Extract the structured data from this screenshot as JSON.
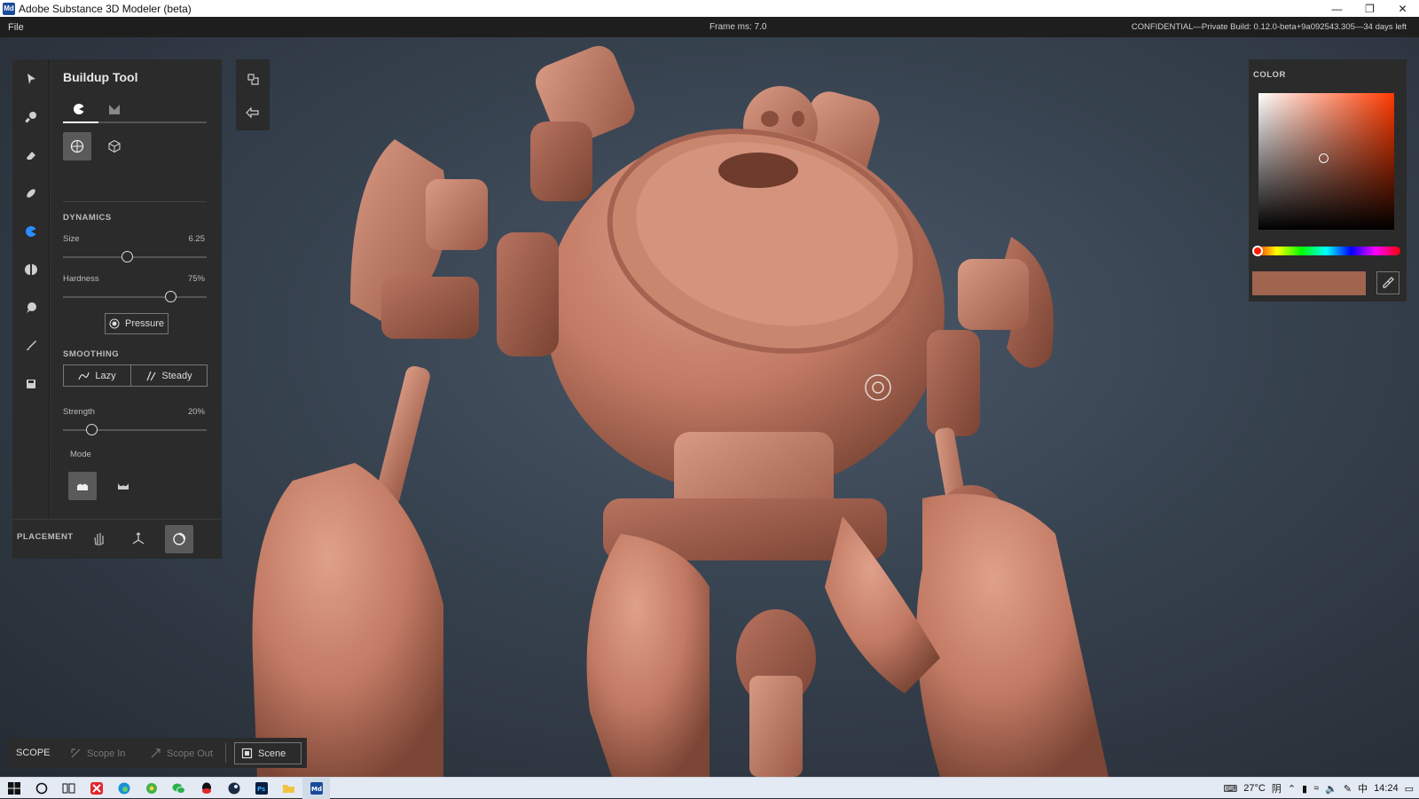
{
  "window": {
    "title": "Adobe Substance 3D Modeler (beta)",
    "app_icon_text": "Md"
  },
  "menubar": {
    "file": "File",
    "frame": "Frame ms: 7.0",
    "confidential": "CONFIDENTIAL—Private Build: 0.12.0-beta+9a092543.305—34 days left"
  },
  "tool_panel": {
    "title": "Buildup Tool",
    "dynamics_label": "DYNAMICS",
    "size_label": "Size",
    "size_value": "6.25",
    "size_fraction": 0.45,
    "hardness_label": "Hardness",
    "hardness_value": "75%",
    "hardness_fraction": 0.75,
    "pressure_label": "Pressure",
    "smoothing_label": "SMOOTHING",
    "lazy_label": "Lazy",
    "steady_label": "Steady",
    "strength_label": "Strength",
    "strength_value": "20%",
    "strength_fraction": 0.2,
    "mode_label": "Mode"
  },
  "placement": {
    "label": "PLACEMENT"
  },
  "color_panel": {
    "label": "COLOR",
    "swatch": "#a0644f",
    "hue": "#ff3a00"
  },
  "scope": {
    "label": "SCOPE",
    "scope_in": "Scope In",
    "scope_out": "Scope Out",
    "scene": "Scene"
  },
  "taskbar": {
    "temperature": "27°C",
    "ime1": "阴",
    "ime2": "中",
    "time": "14:24"
  },
  "colors": {
    "clay": "#c47e68",
    "panel": "#2b2b2b"
  }
}
